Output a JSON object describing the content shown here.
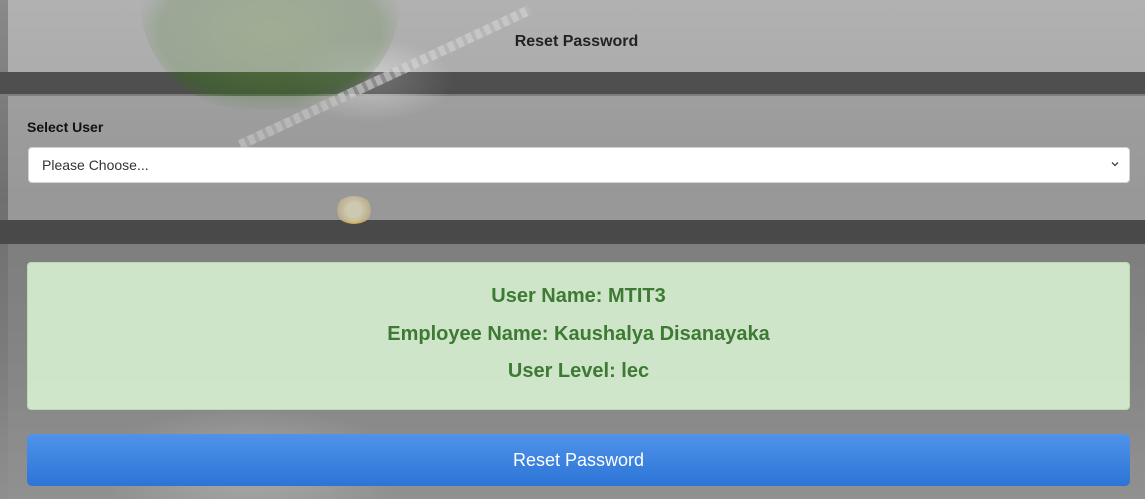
{
  "header": {
    "title": "Reset Password"
  },
  "select_user": {
    "label": "Select User",
    "selected": "Please Choose...",
    "icon": "chevron-down-icon"
  },
  "user_info": {
    "user_name": "User Name: MTIT3",
    "employee_name": "Employee Name: Kaushalya Disanayaka",
    "user_level": "User Level: lec"
  },
  "actions": {
    "reset_label": "Reset Password"
  },
  "colors": {
    "success_text": "#3d7a33",
    "success_bg": "#d6eecf",
    "primary_button": "#2c74d6"
  }
}
